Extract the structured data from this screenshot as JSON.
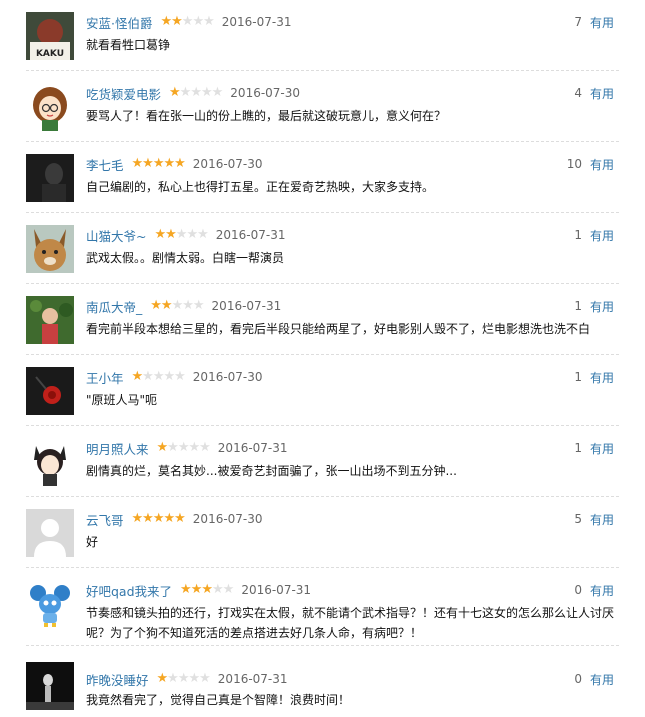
{
  "comments": [
    {
      "user": "安蓝·怪伯爵",
      "rating": 2,
      "stars": 5,
      "date": "2016-07-31",
      "votes": "7",
      "useful_label": "有用",
      "text": "就看看牲口葛铮",
      "avatar": "avatar-kaku"
    },
    {
      "user": "吃货颖爱电影",
      "rating": 1,
      "stars": 5,
      "date": "2016-07-30",
      "votes": "4",
      "useful_label": "有用",
      "text": "要骂人了！看在张一山的份上瞧的，最后就这破玩意儿，意义何在？",
      "avatar": "avatar-cartoon-girl"
    },
    {
      "user": "李七毛",
      "rating": 5,
      "stars": 5,
      "date": "2016-07-30",
      "votes": "10",
      "useful_label": "有用",
      "text": "自己编剧的，私心上也得打五星。正在爱奇艺热映，大家多支持。",
      "avatar": "avatar-dark-photo"
    },
    {
      "user": "山猫大爷~",
      "rating": 2,
      "stars": 5,
      "date": "2016-07-31",
      "votes": "1",
      "useful_label": "有用",
      "text": "武戏太假。。剧情太弱。白瞎一帮演员",
      "avatar": "avatar-lynx"
    },
    {
      "user": "南瓜大帝_",
      "rating": 2,
      "stars": 5,
      "date": "2016-07-31",
      "votes": "1",
      "useful_label": "有用",
      "text": "看完前半段本想给三星的，看完后半段只能给两星了，好电影别人毁不了，烂电影想洗也洗不白",
      "avatar": "avatar-child-garden"
    },
    {
      "user": "王小年",
      "rating": 1,
      "stars": 5,
      "date": "2016-07-30",
      "votes": "1",
      "useful_label": "有用",
      "text": "\"原班人马\"呃",
      "avatar": "avatar-red-flower"
    },
    {
      "user": "明月照人来",
      "rating": 1,
      "stars": 5,
      "date": "2016-07-31",
      "votes": "1",
      "useful_label": "有用",
      "text": "剧情真的烂，莫名其妙...被爱奇艺封面骗了，张一山出场不到五分钟...",
      "avatar": "avatar-anime-girl"
    },
    {
      "user": "云飞哥",
      "rating": 5,
      "stars": 5,
      "date": "2016-07-30",
      "votes": "5",
      "useful_label": "有用",
      "text": "好",
      "avatar": "avatar-default"
    },
    {
      "user": "好吧qad我来了",
      "rating": 3,
      "stars": 5,
      "date": "2016-07-31",
      "votes": "0",
      "useful_label": "有用",
      "text": "节奏感和镜头拍的还行，打戏实在太假，就不能请个武术指导？！还有十七这女的怎么那么让人讨厌呢？为了个狗不知道死活的差点搭进去好几条人命，有病吧？！",
      "avatar": "avatar-blue-toy"
    },
    {
      "user": "昨晚没睡好",
      "rating": 1,
      "stars": 5,
      "date": "2016-07-31",
      "votes": "0",
      "useful_label": "有用",
      "text": "我竟然看完了，觉得自己真是个智障！浪费时间！",
      "avatar": "avatar-dark-stage"
    }
  ],
  "colors": {
    "link": "#3377aa",
    "star_on": "#f5a623",
    "star_off": "#e0e0e0"
  }
}
